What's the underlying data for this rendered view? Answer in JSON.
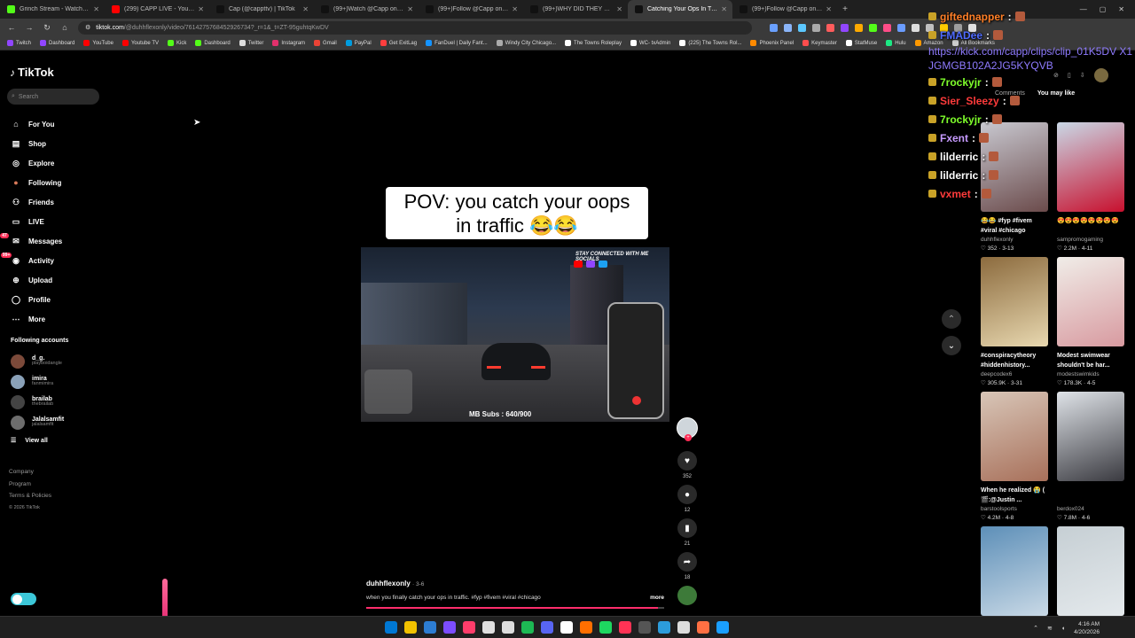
{
  "browser": {
    "tabs": [
      {
        "label": "Grinch Stream - Watch Live on",
        "color": "#53fc18"
      },
      {
        "label": "(299) CAPP LIVE - YouTube",
        "color": "#ff0000"
      },
      {
        "label": "Cap (@cappttv) | TikTok",
        "color": "#111111"
      },
      {
        "label": "(99+)Watch @Capp on kick/Ti",
        "color": "#111111"
      },
      {
        "label": "(99+)Follow @Capp on kick/Ti",
        "color": "#111111"
      },
      {
        "label": "(99+)WHY DID THEY DO BOY !",
        "color": "#111111"
      },
      {
        "label": "Catching Your Ops In Traffic A",
        "color": "#111111",
        "active": true
      },
      {
        "label": "(99+)Follow @Capp on kick/Tw",
        "color": "#111111"
      }
    ],
    "new_tab": "+",
    "url_host": "tiktok.com",
    "url_path": "/@duhhflexonly/video/7614275768452926734?_r=1&_t=ZT-95guhtqKwDV",
    "bookmarks": [
      {
        "label": "Twitch",
        "color": "#9146ff"
      },
      {
        "label": "Dashboard",
        "color": "#9146ff"
      },
      {
        "label": "YouTube",
        "color": "#ff0000"
      },
      {
        "label": "Youtube TV",
        "color": "#ff0000"
      },
      {
        "label": "Kick",
        "color": "#53fc18"
      },
      {
        "label": "Dashboard",
        "color": "#53fc18"
      },
      {
        "label": "Twitter",
        "color": "#dddddd"
      },
      {
        "label": "Instagram",
        "color": "#e1306c"
      },
      {
        "label": "Gmail",
        "color": "#ea4335"
      },
      {
        "label": "PayPal",
        "color": "#009cde"
      },
      {
        "label": "Get ExitLag",
        "color": "#ff3e3e"
      },
      {
        "label": "FanDuel | Daily Fant...",
        "color": "#1493ff"
      },
      {
        "label": "Windy City Chicago...",
        "color": "#aaaaaa"
      },
      {
        "label": "The Towns Roleplay",
        "color": "#ffffff"
      },
      {
        "label": "WC- txAdmin",
        "color": "#ffffff"
      },
      {
        "label": "(225) The Towns Rol...",
        "color": "#ffffff"
      },
      {
        "label": "Phoenix Panel",
        "color": "#ff8a00"
      },
      {
        "label": "Keymaster",
        "color": "#ff4d4d"
      },
      {
        "label": "StatMuse",
        "color": "#ffffff"
      },
      {
        "label": "Hulu",
        "color": "#1ce783"
      },
      {
        "label": "Amazon",
        "color": "#ff9900"
      },
      {
        "label": "All Bookmarks",
        "color": "#cccccc"
      }
    ]
  },
  "sidebar": {
    "logo": "TikTok",
    "search_placeholder": "Search",
    "nav": [
      {
        "label": "For You",
        "icon": "home-icon",
        "glyph": "⌂"
      },
      {
        "label": "Shop",
        "icon": "shop-icon",
        "glyph": "▤"
      },
      {
        "label": "Explore",
        "icon": "compass-icon",
        "glyph": "◎"
      },
      {
        "label": "Following",
        "icon": "following-avatar-icon",
        "glyph": "●"
      },
      {
        "label": "Friends",
        "icon": "friends-icon",
        "glyph": "⚇"
      },
      {
        "label": "LIVE",
        "icon": "live-icon",
        "glyph": "▭"
      },
      {
        "label": "Messages",
        "icon": "messages-icon",
        "glyph": "✉"
      },
      {
        "label": "Activity",
        "icon": "activity-icon",
        "glyph": "◉"
      },
      {
        "label": "Upload",
        "icon": "upload-icon",
        "glyph": "⊕"
      },
      {
        "label": "Profile",
        "icon": "profile-icon",
        "glyph": "◯"
      },
      {
        "label": "More",
        "icon": "more-icon",
        "glyph": "⋯"
      }
    ],
    "messages_badge": "47",
    "activity_badge": "99+",
    "following_heading": "Following accounts",
    "following": [
      {
        "name": "d_g.",
        "user": "playboidangle",
        "color": "#7c4a3a"
      },
      {
        "name": "imira",
        "user": "fanmimira",
        "color": "#8aa1b8"
      },
      {
        "name": "brailab",
        "user": "thebrailab",
        "color": "#444444"
      },
      {
        "name": "Jalalsamfit",
        "user": "jalalsamfit",
        "color": "#6d6d6d"
      }
    ],
    "view_all": "View all",
    "footer": [
      "Company",
      "Program",
      "Terms & Policies"
    ],
    "copyright": "© 2026 TikTok"
  },
  "video": {
    "caption_line1": "POV: you catch your oops",
    "caption_line2": "in traffic 😂😂",
    "overlay_text": "STAY CONNECTED WITH ME SOCIALS",
    "subs_text": "MB Subs : 640/900",
    "author": "duhhflexonly",
    "date": "· 3-6",
    "description": "when you finally catch your ops in traffic. #fyp #fivem #viral #chicago",
    "more": "more",
    "progress": 0.98
  },
  "actions": [
    {
      "name": "like",
      "icon": "heart-icon",
      "glyph": "♥",
      "count": "352"
    },
    {
      "name": "comment",
      "icon": "comment-icon",
      "glyph": "●",
      "count": "12"
    },
    {
      "name": "bookmark",
      "icon": "bookmark-icon",
      "glyph": "▮",
      "count": "21"
    },
    {
      "name": "share",
      "icon": "share-icon",
      "glyph": "➦",
      "count": "18"
    }
  ],
  "right_panel": {
    "tabs": [
      "Comments",
      "You may like"
    ],
    "cards": [
      {
        "title": "😂😂 #fyp #fivem #viral #chicago",
        "user": "duhhflexonly",
        "meta": "♡ 352 · 3-13",
        "c1": "#c8c8d0",
        "c2": "#6b4b4b"
      },
      {
        "title": "😍😍😍😍😍😍😍😍",
        "user": "sampromogaming",
        "meta": "♡ 2.2M · 4-11",
        "c1": "#c9d8e6",
        "c2": "#c8102e"
      },
      {
        "title": "#conspiracytheory #hiddenhistory...",
        "user": "deepcodex6",
        "meta": "♡ 305.9K · 3-31",
        "c1": "#8c6b3e",
        "c2": "#e8d8b0"
      },
      {
        "title": "Modest swimwear shouldn't be har...",
        "user": "modestswimkids",
        "meta": "♡ 178.3K · 4-5",
        "c1": "#f0ede8",
        "c2": "#d89aa0"
      },
      {
        "title": "When he realized 😭 ( 🎬:@Justin ...",
        "user": "barstoolsports",
        "meta": "♡ 4.2M · 4-8",
        "c1": "#d8c6b8",
        "c2": "#a8705a"
      },
      {
        "title": "",
        "user": "berdox024",
        "meta": "♡ 7.8M · 4-6",
        "c1": "#dfe3e8",
        "c2": "#3a3a40"
      },
      {
        "title": "",
        "user": "",
        "meta": "",
        "c1": "#5d8fb8",
        "c2": "#c9d9e6"
      },
      {
        "title": "",
        "user": "",
        "meta": "",
        "c1": "#c6cfd4",
        "c2": "#e4e9ec"
      }
    ]
  },
  "chat": {
    "lines": [
      {
        "name": "giftednapper",
        "color": "#ff7f27"
      },
      {
        "name": "FMADee",
        "color": "#4f6bff"
      }
    ],
    "url": "https://kick.com/capp/clips/clip_01K5DV X1JGMGB102A2JG5KYQVB",
    "lines2": [
      {
        "name": "7rockyjr",
        "color": "#7fff2b"
      },
      {
        "name": "Sier_Sleezy",
        "color": "#ff3b3b"
      },
      {
        "name": "7rockyjr",
        "color": "#7fff2b"
      },
      {
        "name": "Fxent",
        "color": "#c79bff"
      },
      {
        "name": "lilderric",
        "color": "#ffffff"
      },
      {
        "name": "lilderric",
        "color": "#ffffff"
      },
      {
        "name": "vxmet",
        "color": "#ff3b3b"
      }
    ]
  },
  "taskbar": {
    "apps": [
      "#0078d4",
      "#f2c200",
      "#2d7dd2",
      "#7c4dff",
      "#ff3d6b",
      "#e0e0e0",
      "#dddddd",
      "#1db954",
      "#5865f2",
      "#ffffff",
      "#ff6f00",
      "#1ed760",
      "#ff3355",
      "#555555",
      "#2c9cdb",
      "#dddddd",
      "#ff7043",
      "#1a9fff"
    ],
    "time": "4:16 AM",
    "date": "4/20/2026"
  }
}
